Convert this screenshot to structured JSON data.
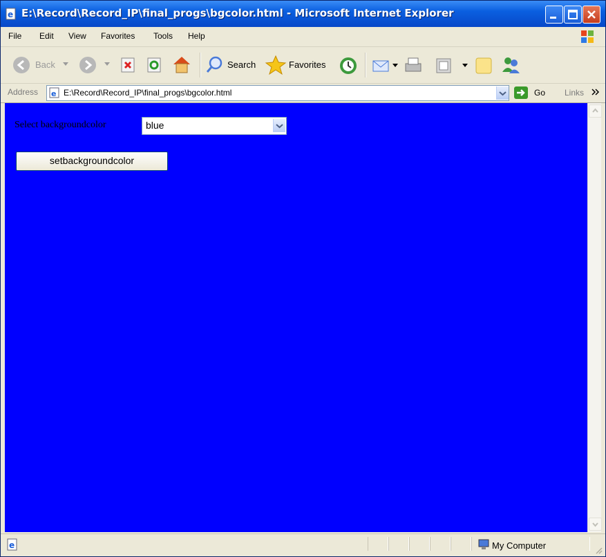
{
  "window": {
    "title": "E:\\Record\\Record_IP\\final_progs\\bgcolor.html - Microsoft Internet Explorer"
  },
  "menu": [
    "File",
    "Edit",
    "View",
    "Favorites",
    "Tools",
    "Help"
  ],
  "toolbar": {
    "back_label": "Back",
    "search_label": "Search",
    "favorites_label": "Favorites"
  },
  "address": {
    "label": "Address",
    "url": "E:\\Record\\Record_IP\\final_progs\\bgcolor.html",
    "go_label": "Go",
    "links_label": "Links"
  },
  "page": {
    "background_color": "#0000ff",
    "select_label": "Select backgroundcolor",
    "selected_color": "blue",
    "button_label": "setbackgroundcolor"
  },
  "status": {
    "zone": "My Computer"
  }
}
